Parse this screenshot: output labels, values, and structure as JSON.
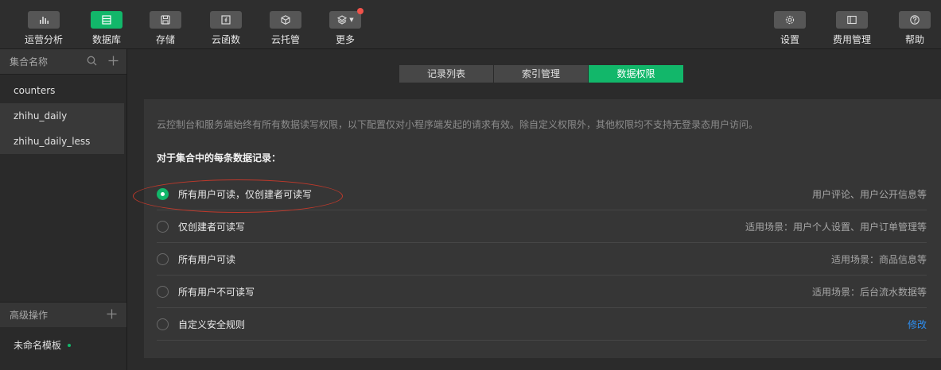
{
  "toolbar": {
    "left": [
      {
        "label": "运营分析",
        "icon": "bar-chart-icon",
        "active": false
      },
      {
        "label": "数据库",
        "icon": "database-icon",
        "active": true
      },
      {
        "label": "存储",
        "icon": "save-icon",
        "active": false
      },
      {
        "label": "云函数",
        "icon": "function-icon",
        "active": false
      },
      {
        "label": "云托管",
        "icon": "cube-icon",
        "active": false
      },
      {
        "label": "更多",
        "icon": "layers-icon",
        "active": false
      }
    ],
    "right": [
      {
        "label": "设置",
        "icon": "gear-icon"
      },
      {
        "label": "费用管理",
        "icon": "panel-icon"
      },
      {
        "label": "帮助",
        "icon": "help-icon"
      }
    ]
  },
  "sidebar": {
    "title": "集合名称",
    "collections": [
      "counters",
      "zhihu_daily",
      "zhihu_daily_less"
    ],
    "selected_index": 1,
    "advanced_title": "高级操作",
    "template": "未命名模板"
  },
  "tabs": [
    "记录列表",
    "索引管理",
    "数据权限"
  ],
  "active_tab": 2,
  "panel": {
    "description": "云控制台和服务端始终有所有数据读写权限，以下配置仅对小程序端发起的请求有效。除自定义权限外，其他权限均不支持无登录态用户访问。",
    "heading": "对于集合中的每条数据记录：",
    "options": [
      {
        "label": "所有用户可读，仅创建者可读写",
        "note": "用户评论、用户公开信息等",
        "checked": true
      },
      {
        "label": "仅创建者可读写",
        "note": "适用场景：用户个人设置、用户订单管理等",
        "checked": false
      },
      {
        "label": "所有用户可读",
        "note": "适用场景：商品信息等",
        "checked": false
      },
      {
        "label": "所有用户不可读写",
        "note": "适用场景：后台流水数据等",
        "checked": false
      },
      {
        "label": "自定义安全规则",
        "link": "修改",
        "checked": false
      }
    ]
  },
  "colors": {
    "accent": "#12b76a",
    "link": "#2e8ef0",
    "annotation": "#c0392b",
    "badge": "#f0524a"
  }
}
